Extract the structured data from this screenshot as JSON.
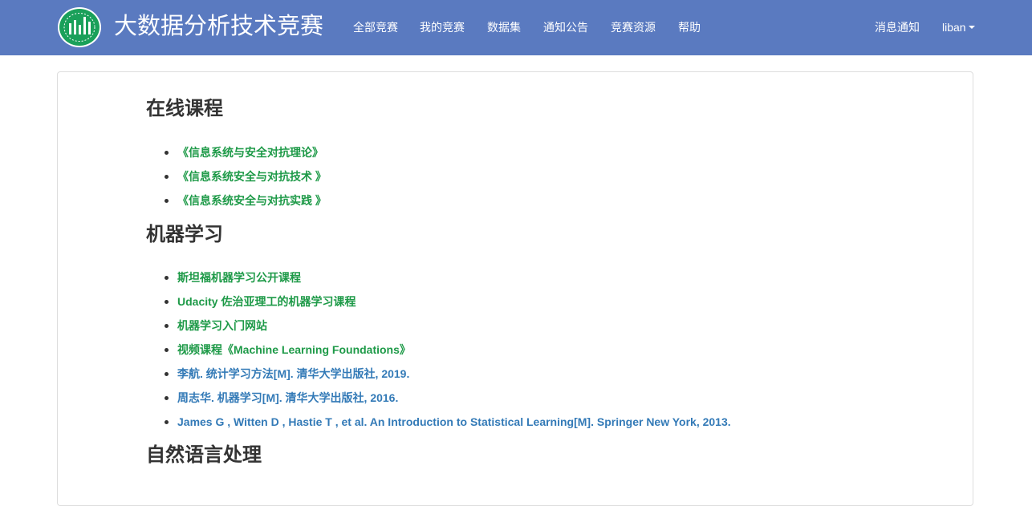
{
  "header": {
    "brand_title": "大数据分析技术竞赛",
    "nav": {
      "all_competitions": "全部竞赛",
      "my_competitions": "我的竞赛",
      "datasets": "数据集",
      "announcements": "通知公告",
      "resources": "竞赛资源",
      "help": "帮助"
    },
    "messages": "消息通知",
    "user": "liban"
  },
  "colors": {
    "navbar": "#5a7ac0",
    "link_green": "#1e9a48",
    "link_blue": "#337ab7",
    "logo_green": "#1aa05a"
  },
  "sections": {
    "online_courses": {
      "title": "在线课程",
      "items": [
        "《信息系统与安全对抗理论》",
        "《信息系统安全与对抗技术 》",
        "《信息系统安全与对抗实践 》"
      ]
    },
    "machine_learning": {
      "title": "机器学习",
      "items": [
        "斯坦福机器学习公开课程",
        "Udacity 佐治亚理工的机器学习课程",
        "机器学习入门网站",
        "视频课程《Machine Learning Foundations》",
        "李航. 统计学习方法[M]. 清华大学出版社, 2019.",
        "周志华. 机器学习[M]. 清华大学出版社, 2016.",
        "James G , Witten D , Hastie T , et al. An Introduction to Statistical Learning[M]. Springer New York, 2013."
      ]
    },
    "nlp": {
      "title": "自然语言处理"
    }
  }
}
